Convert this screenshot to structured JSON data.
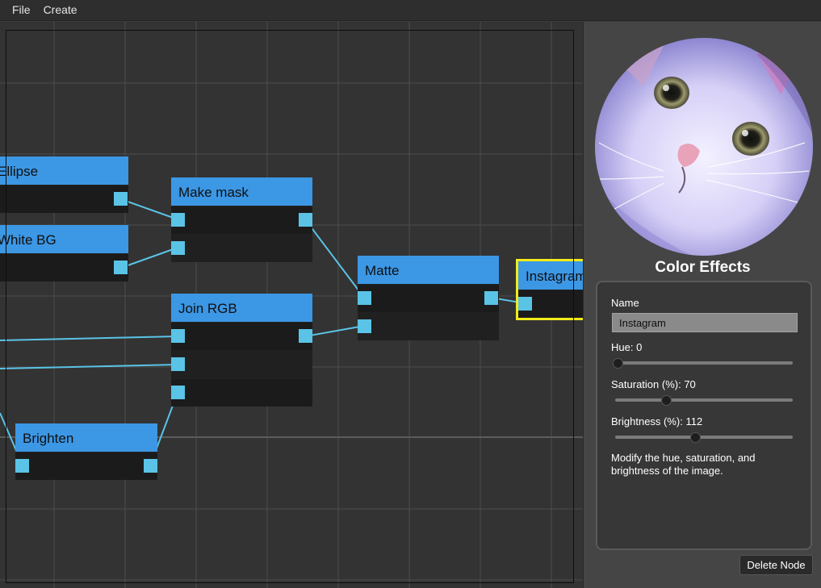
{
  "menubar": {
    "items": [
      "File",
      "Create"
    ]
  },
  "colors": {
    "node_header": "#3c97e4",
    "port": "#5ac3e6",
    "wire": "#5ac3e6",
    "selection": "#f2ea1b"
  },
  "graph": {
    "nodes": {
      "ellipse": {
        "title": "Ellipse"
      },
      "white_bg": {
        "title": "White BG"
      },
      "make_mask": {
        "title": "Make mask"
      },
      "join_rgb": {
        "title": "Join RGB"
      },
      "brighten": {
        "title": "Brighten"
      },
      "matte": {
        "title": "Matte"
      },
      "instagram": {
        "title": "Instagram"
      }
    }
  },
  "panel": {
    "title": "Color Effects",
    "preview_icon": "cat-photo",
    "name_label": "Name",
    "name_value": "Instagram",
    "hue_label": "Hue: 0",
    "hue_value": 0,
    "saturation_label": "Saturation (%): 70",
    "saturation_value": 70,
    "brightness_label": "Brightness (%): 112",
    "brightness_value": 112,
    "description": "Modify the hue, saturation, and brightness of the image.",
    "delete_label": "Delete Node"
  }
}
